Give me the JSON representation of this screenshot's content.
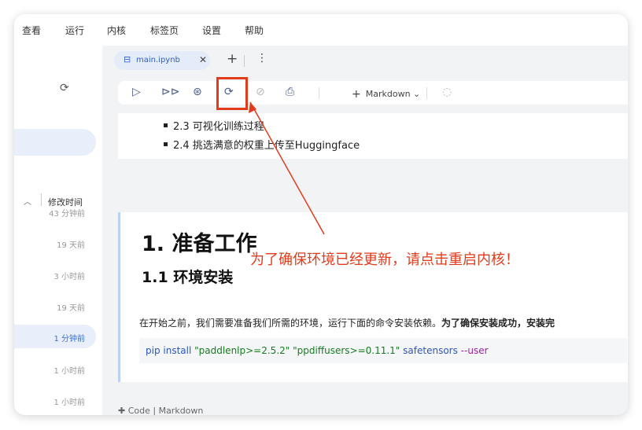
{
  "menubar": {
    "items": [
      "查看",
      "运行",
      "内核",
      "标签页",
      "设置",
      "帮助"
    ]
  },
  "sidebar": {
    "header_label": "修改时间",
    "rows": [
      "43 分钟前",
      "19 天前",
      "3 小时前",
      "19 天前",
      "1 分钟前",
      "1 小时前",
      "1 小时前"
    ],
    "active_row": 4
  },
  "tabs": [
    {
      "label": "main.ipynb",
      "icon": "notebook-file-icon"
    }
  ],
  "toolbar": {
    "buttons": [
      "run-icon",
      "run-all-icon",
      "restart-run-icon",
      "restart-kernel-icon",
      "interrupt-icon",
      "save-icon"
    ],
    "cell_type": "Markdown",
    "highlight_color": "#e23b1c"
  },
  "cells": {
    "toc_items": [
      "2.3 可视化训练过程",
      "2.4 挑选满意的权重上传至Huggingface"
    ],
    "h1": "1. 准备工作",
    "h2": "1.1 环境安装",
    "paragraph": "在开始之前，我们需要准备我们所需的环境，运行下面的命令安装依赖。",
    "paragraph_bold": "为了确保安装成功，安装完",
    "code": {
      "cmd": "pip install ",
      "arg1": "\"paddlenlp>=2.5.2\"",
      "arg2": "\"ppdiffusers>=0.11.1\"",
      "arg3": "safetensors",
      "flag": "--user"
    }
  },
  "annotation": "为了确保环境已经更新，请点击重启内核！",
  "bottom_text": "✚ Code   |   Markdown"
}
